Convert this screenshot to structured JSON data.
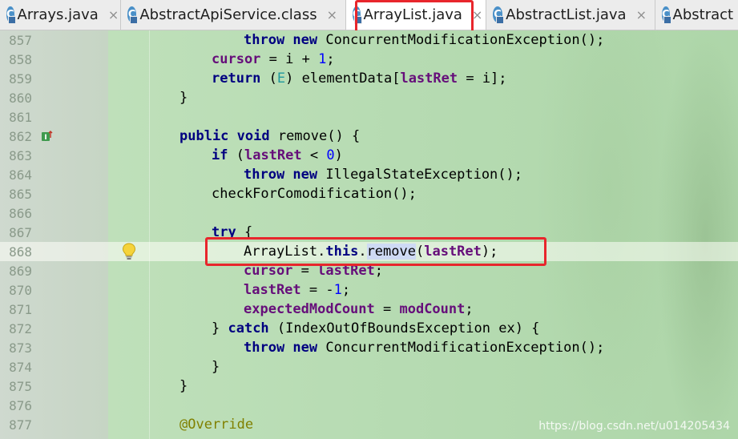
{
  "tabs": [
    {
      "label": "Arrays.java",
      "icon": "class-icon",
      "close": "×"
    },
    {
      "label": "AbstractApiService.class",
      "icon": "class-icon",
      "close": "×"
    },
    {
      "label": "ArrayList.java",
      "icon": "class-icon",
      "close": "×",
      "active": true
    },
    {
      "label": "AbstractList.java",
      "icon": "class-icon",
      "close": "×"
    },
    {
      "label": "Abstract",
      "icon": "class-icon",
      "close": ""
    }
  ],
  "code_lines": [
    {
      "num": "857",
      "text": "throw new ConcurrentModificationException();"
    },
    {
      "num": "858",
      "text": "cursor = i + 1;"
    },
    {
      "num": "859",
      "text": "return (E) elementData[lastRet = i];"
    },
    {
      "num": "860",
      "text": "}"
    },
    {
      "num": "861",
      "text": ""
    },
    {
      "num": "862",
      "text": "public void remove() {"
    },
    {
      "num": "863",
      "text": "if (lastRet < 0)"
    },
    {
      "num": "864",
      "text": "throw new IllegalStateException();"
    },
    {
      "num": "865",
      "text": "checkForComodification();"
    },
    {
      "num": "866",
      "text": ""
    },
    {
      "num": "867",
      "text": "try {"
    },
    {
      "num": "868",
      "text": "ArrayList.this.remove(lastRet);"
    },
    {
      "num": "869",
      "text": "cursor = lastRet;"
    },
    {
      "num": "870",
      "text": "lastRet = -1;"
    },
    {
      "num": "871",
      "text": "expectedModCount = modCount;"
    },
    {
      "num": "872",
      "text": "} catch (IndexOutOfBoundsException ex) {"
    },
    {
      "num": "873",
      "text": "throw new ConcurrentModificationException();"
    },
    {
      "num": "874",
      "text": "}"
    },
    {
      "num": "875",
      "text": "}"
    },
    {
      "num": "876",
      "text": ""
    },
    {
      "num": "877",
      "text": "@Override"
    }
  ],
  "watermark": "https://blog.csdn.net/u014205434",
  "colors": {
    "highlight_box": "#e8262c",
    "keyword": "#000080",
    "field": "#660e7a",
    "number": "#0000ff"
  }
}
